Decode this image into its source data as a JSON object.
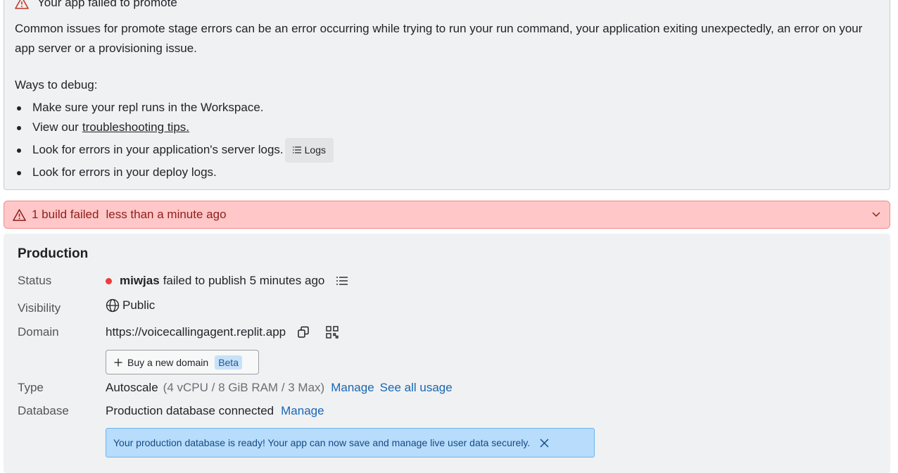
{
  "error_box": {
    "title": "Your app failed to promote",
    "description": "Common issues for promote stage errors can be an error occurring while trying to run your run command, your application exiting unexpectedly, an error on your app server or a provisioning issue.",
    "debug_title": "Ways to debug:",
    "bullet_1": "Make sure your repl runs in the Workspace.",
    "bullet_2_prefix": "View our",
    "bullet_2_link": "troubleshooting tips.",
    "bullet_3": "Look for errors in your application's server logs.",
    "logs_button": "Logs",
    "bullet_4": "Look for errors in your deploy logs."
  },
  "build_bar": {
    "count": "1 build failed",
    "time": "less than a minute ago"
  },
  "production": {
    "title": "Production",
    "status_label": "Status",
    "status_user": "miwjas",
    "status_text": "failed to publish 5 minutes ago",
    "visibility_label": "Visibility",
    "visibility_value": "Public",
    "domain_label": "Domain",
    "domain_value": "https://voicecallingagent.replit.app",
    "buy_domain_label": "Buy a new domain",
    "beta_badge": "Beta",
    "type_label": "Type",
    "type_value": "Autoscale",
    "type_spec": "(4 vCPU / 8 GiB RAM / 3 Max)",
    "type_manage": "Manage",
    "type_usage": "See all usage",
    "database_label": "Database",
    "database_value": "Production database connected",
    "database_manage": "Manage",
    "db_banner": "Your production database is ready! Your app can now save and manage live user data securely."
  },
  "colors": {
    "error_red": "#8f1d1d",
    "error_bg": "#ffc7c7",
    "link_blue": "#1966b3",
    "status_dot": "#ef3b3b",
    "info_bg": "#b7dcfc"
  },
  "icons": [
    "warning-icon",
    "list-icon",
    "chevron-down-icon",
    "globe-icon",
    "copy-icon",
    "qr-code-icon",
    "plus-icon",
    "close-icon"
  ]
}
